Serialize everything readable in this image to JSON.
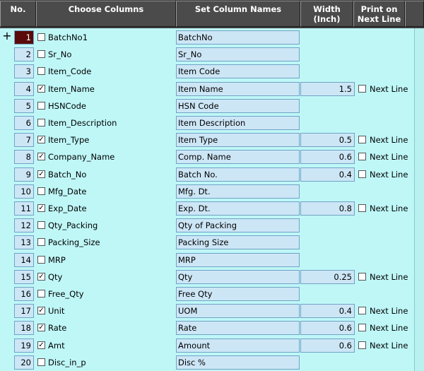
{
  "headers": {
    "no": "No.",
    "choose": "Choose Columns",
    "set_names": "Set Column Names",
    "width": "Width (Inch)",
    "print": "Print on Next Line"
  },
  "row_selector": "+",
  "rows": [
    {
      "no": "1",
      "selected": false,
      "column": "BatchNo1",
      "name": "BatchNo",
      "width": "",
      "next_line": null,
      "active": true
    },
    {
      "no": "2",
      "selected": false,
      "column": "Sr_No",
      "name": "Sr_No",
      "width": "",
      "next_line": null
    },
    {
      "no": "3",
      "selected": false,
      "column": "Item_Code",
      "name": "Item Code",
      "width": "",
      "next_line": null
    },
    {
      "no": "4",
      "selected": true,
      "column": "Item_Name",
      "name": "Item Name",
      "width": "1.5",
      "next_line": false
    },
    {
      "no": "5",
      "selected": false,
      "column": "HSNCode",
      "name": "HSN Code",
      "width": "",
      "next_line": null
    },
    {
      "no": "6",
      "selected": false,
      "column": "Item_Description",
      "name": "Item Description",
      "width": "",
      "next_line": null
    },
    {
      "no": "7",
      "selected": true,
      "column": "Item_Type",
      "name": "Item Type",
      "width": "0.5",
      "next_line": false
    },
    {
      "no": "8",
      "selected": true,
      "column": "Company_Name",
      "name": "Comp. Name",
      "width": "0.6",
      "next_line": false
    },
    {
      "no": "9",
      "selected": true,
      "column": "Batch_No",
      "name": "Batch No.",
      "width": "0.4",
      "next_line": false
    },
    {
      "no": "10",
      "selected": false,
      "column": "Mfg_Date",
      "name": "Mfg. Dt.",
      "width": "",
      "next_line": null
    },
    {
      "no": "11",
      "selected": true,
      "column": "Exp_Date",
      "name": "Exp. Dt.",
      "width": "0.8",
      "next_line": false
    },
    {
      "no": "12",
      "selected": false,
      "column": "Qty_Packing",
      "name": "Qty of Packing",
      "width": "",
      "next_line": null
    },
    {
      "no": "13",
      "selected": false,
      "column": "Packing_Size",
      "name": "Packing Size",
      "width": "",
      "next_line": null
    },
    {
      "no": "14",
      "selected": false,
      "column": "MRP",
      "name": "MRP",
      "width": "",
      "next_line": null
    },
    {
      "no": "15",
      "selected": true,
      "column": "Qty",
      "name": "Qty",
      "width": "0.25",
      "next_line": false
    },
    {
      "no": "16",
      "selected": false,
      "column": "Free_Qty",
      "name": "Free Qty",
      "width": "",
      "next_line": null
    },
    {
      "no": "17",
      "selected": true,
      "column": "Unit",
      "name": "UOM",
      "width": "0.4",
      "next_line": false
    },
    {
      "no": "18",
      "selected": true,
      "column": "Rate",
      "name": "Rate",
      "width": "0.6",
      "next_line": false
    },
    {
      "no": "19",
      "selected": true,
      "column": "Amt",
      "name": "Amount",
      "width": "0.6",
      "next_line": false
    },
    {
      "no": "20",
      "selected": false,
      "column": "Disc_in_p",
      "name": "Disc %",
      "width": "",
      "next_line": null
    }
  ],
  "next_line_label": "Next Line",
  "check_glyph": "✓"
}
